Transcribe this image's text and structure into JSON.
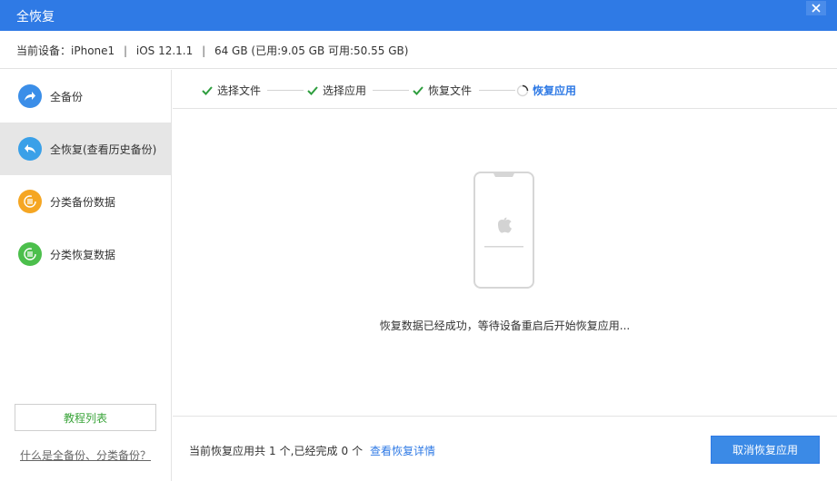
{
  "window": {
    "title": "全恢复",
    "close_icon": "close-icon"
  },
  "device": {
    "current_label": "当前设备：",
    "name": "iPhone1",
    "os": "iOS 12.1.1",
    "storage": "64 GB (已用:9.05 GB 可用:50.55 GB)"
  },
  "sidebar": {
    "items": [
      {
        "label": "全备份",
        "icon": "share-arrow-icon",
        "color": "#3b8ee8",
        "active": false
      },
      {
        "label": "全恢复(查看历史备份)",
        "icon": "reply-arrow-icon",
        "color": "#3aa0e8",
        "active": true
      },
      {
        "label": "分类备份数据",
        "icon": "category-backup-icon",
        "color": "#f5a623",
        "active": false
      },
      {
        "label": "分类恢复数据",
        "icon": "category-restore-icon",
        "color": "#4cbf4c",
        "active": false
      }
    ],
    "tutorial_button": "教程列表",
    "help_link": "什么是全备份、分类备份？"
  },
  "steps": [
    {
      "label": "选择文件",
      "state": "done"
    },
    {
      "label": "选择应用",
      "state": "done"
    },
    {
      "label": "恢复文件",
      "state": "done"
    },
    {
      "label": "恢复应用",
      "state": "in-progress"
    }
  ],
  "main": {
    "message": "恢复数据已经成功，等待设备重启后开始恢复应用..."
  },
  "footer": {
    "prefix": "当前恢复应用共",
    "total": "1",
    "middle": "个,已经完成",
    "completed": "0",
    "suffix": "个",
    "detail_link": "查看恢复详情",
    "cancel_button": "取消恢复应用"
  },
  "colors": {
    "accent": "#2f7ae5",
    "done_check": "#2e9e3e",
    "tutorial_text": "#3aa43a"
  }
}
